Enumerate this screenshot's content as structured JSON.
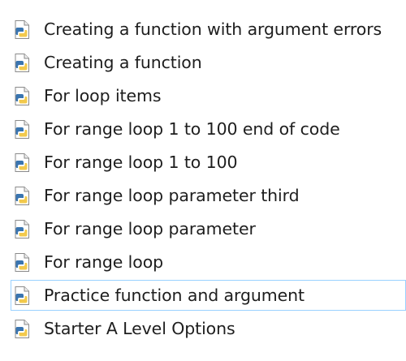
{
  "file_list": {
    "items": [
      {
        "label": "Creating a function with argument errors",
        "icon": "python-file-icon",
        "hovered": false
      },
      {
        "label": "Creating a function",
        "icon": "python-file-icon",
        "hovered": false
      },
      {
        "label": "For loop items",
        "icon": "python-file-icon",
        "hovered": false
      },
      {
        "label": "For range loop 1 to 100 end of code",
        "icon": "python-file-icon",
        "hovered": false
      },
      {
        "label": "For range loop 1 to 100",
        "icon": "python-file-icon",
        "hovered": false
      },
      {
        "label": "For range loop parameter third",
        "icon": "python-file-icon",
        "hovered": false
      },
      {
        "label": "For range loop parameter",
        "icon": "python-file-icon",
        "hovered": false
      },
      {
        "label": "For range loop",
        "icon": "python-file-icon",
        "hovered": false
      },
      {
        "label": "Practice function and argument",
        "icon": "python-file-icon",
        "hovered": true
      },
      {
        "label": "Starter A Level Options",
        "icon": "python-file-icon",
        "hovered": false
      }
    ]
  },
  "colors": {
    "hover_border": "#99d1ff",
    "python_blue": "#3a75b0",
    "python_yellow": "#f2c94c",
    "text": "#1e1e1e"
  }
}
